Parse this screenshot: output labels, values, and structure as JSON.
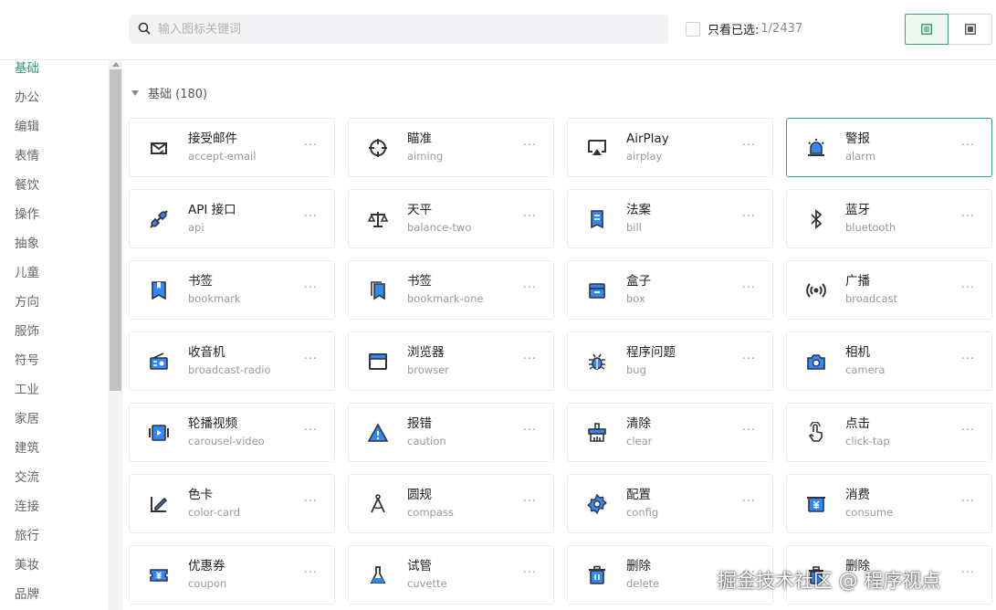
{
  "search": {
    "placeholder": "输入图标关键词"
  },
  "filter": {
    "only_selected_label": "只看已选:",
    "count": "1/2437"
  },
  "sidebar": {
    "items": [
      "基础",
      "办公",
      "编辑",
      "表情",
      "餐饮",
      "操作",
      "抽象",
      "儿童",
      "方向",
      "服饰",
      "符号",
      "工业",
      "家居",
      "建筑",
      "交流",
      "连接",
      "旅行",
      "美妆",
      "品牌"
    ]
  },
  "group": {
    "title": "基础 (180)"
  },
  "icons": [
    {
      "name": "接受邮件",
      "id": "accept-email",
      "icon": "mail-icon"
    },
    {
      "name": "瞄准",
      "id": "aiming",
      "icon": "crosshair-icon"
    },
    {
      "name": "AirPlay",
      "id": "airplay",
      "icon": "airplay-icon"
    },
    {
      "name": "警报",
      "id": "alarm",
      "icon": "siren-icon"
    },
    {
      "name": "API 接口",
      "id": "api",
      "icon": "plug-icon"
    },
    {
      "name": "天平",
      "id": "balance-two",
      "icon": "scale-icon"
    },
    {
      "name": "法案",
      "id": "bill",
      "icon": "bill-icon"
    },
    {
      "name": "蓝牙",
      "id": "bluetooth",
      "icon": "bluetooth-icon"
    },
    {
      "name": "书签",
      "id": "bookmark",
      "icon": "bookmark-icon"
    },
    {
      "name": "书签",
      "id": "bookmark-one",
      "icon": "bookmark-one-icon"
    },
    {
      "name": "盒子",
      "id": "box",
      "icon": "box-icon"
    },
    {
      "name": "广播",
      "id": "broadcast",
      "icon": "broadcast-icon"
    },
    {
      "name": "收音机",
      "id": "broadcast-radio",
      "icon": "radio-icon"
    },
    {
      "name": "浏览器",
      "id": "browser",
      "icon": "browser-icon"
    },
    {
      "name": "程序问题",
      "id": "bug",
      "icon": "bug-icon"
    },
    {
      "name": "相机",
      "id": "camera",
      "icon": "camera-icon"
    },
    {
      "name": "轮播视频",
      "id": "carousel-video",
      "icon": "carousel-video-icon"
    },
    {
      "name": "报错",
      "id": "caution",
      "icon": "caution-icon"
    },
    {
      "name": "清除",
      "id": "clear",
      "icon": "clear-icon"
    },
    {
      "name": "点击",
      "id": "click-tap",
      "icon": "click-tap-icon"
    },
    {
      "name": "色卡",
      "id": "color-card",
      "icon": "color-card-icon"
    },
    {
      "name": "圆规",
      "id": "compass",
      "icon": "compass-icon"
    },
    {
      "name": "配置",
      "id": "config",
      "icon": "config-icon"
    },
    {
      "name": "消费",
      "id": "consume",
      "icon": "consume-icon"
    },
    {
      "name": "优惠券",
      "id": "coupon",
      "icon": "coupon-icon"
    },
    {
      "name": "试管",
      "id": "cuvette",
      "icon": "cuvette-icon"
    },
    {
      "name": "删除",
      "id": "delete",
      "icon": "delete-icon"
    },
    {
      "name": "删除",
      "id": "",
      "icon": "delete-two-icon"
    }
  ],
  "more_label": "···",
  "colors": {
    "accent": "#2e9b72",
    "icon_stroke": "#333333",
    "icon_fill": "#2f88ff"
  },
  "watermark": "掘金技术社区 @ 程序视点"
}
